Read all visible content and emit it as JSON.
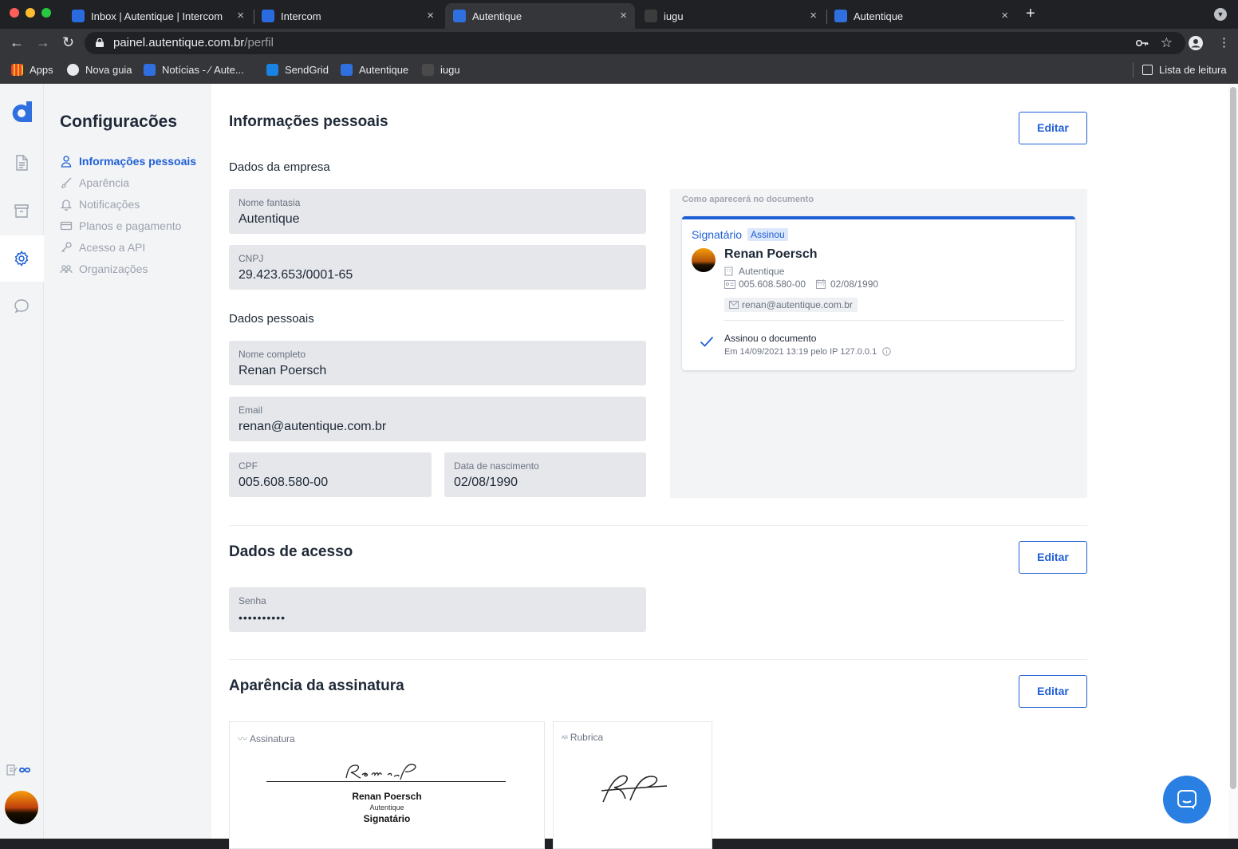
{
  "browser": {
    "tabs": [
      {
        "title": "Inbox | Autentique | Intercom",
        "active": false
      },
      {
        "title": "Intercom",
        "active": false
      },
      {
        "title": "Autentique",
        "active": true
      },
      {
        "title": "iugu",
        "active": false
      },
      {
        "title": "Autentique",
        "active": false
      }
    ],
    "close_glyph": "×",
    "new_tab_glyph": "+",
    "url_host": "painel.autentique.com.br",
    "url_path": "/perfil",
    "bookmarks": [
      "Apps",
      "Nova guia",
      "Notícias - ",
      "Aute...",
      "SendGrid",
      "Autentique",
      "iugu"
    ],
    "reading_list": "Lista de leitura"
  },
  "sidebar": {
    "title": "Configuracões",
    "items": [
      {
        "label": "Informações pessoais",
        "icon": "user-icon",
        "active": true
      },
      {
        "label": "Aparência",
        "icon": "brush-icon",
        "active": false
      },
      {
        "label": "Notificações",
        "icon": "bell-icon",
        "active": false
      },
      {
        "label": "Planos e pagamento",
        "icon": "card-icon",
        "active": false
      },
      {
        "label": "Acesso a API",
        "icon": "key-icon",
        "active": false
      },
      {
        "label": "Organizações",
        "icon": "users-icon",
        "active": false
      }
    ]
  },
  "personal": {
    "title": "Informações pessoais",
    "edit_label": "Editar",
    "company_heading": "Dados da empresa",
    "trade_name_label": "Nome fantasia",
    "trade_name": "Autentique",
    "cnpj_label": "CNPJ",
    "cnpj": "29.423.653/0001-65",
    "personal_heading": "Dados pessoais",
    "full_name_label": "Nome completo",
    "full_name": "Renan Poersch",
    "email_label": "Email",
    "email": "renan@autentique.com.br",
    "cpf_label": "CPF",
    "cpf": "005.608.580-00",
    "birth_label": "Data de nascimento",
    "birth": "02/08/1990"
  },
  "preview": {
    "caption": "Como aparecerá no documento",
    "role": "Signatário",
    "badge": "Assinou",
    "name": "Renan Poersch",
    "company": "Autentique",
    "cpf": "005.608.580-00",
    "birth": "02/08/1990",
    "email": "renan@autentique.com.br",
    "signed": "Assinou o documento",
    "signed_detail": "Em 14/09/2021 13:19 pelo IP 127.0.0.1"
  },
  "access": {
    "title": "Dados de acesso",
    "edit_label": "Editar",
    "password_label": "Senha",
    "password": "••••••••••"
  },
  "signature": {
    "title": "Aparência da assinatura",
    "edit_label": "Editar",
    "sign_caption": "Assinatura",
    "initials_caption": "Rubrica",
    "sign_name": "Renan Poersch",
    "sign_company": "Autentique",
    "sign_role": "Signatário"
  },
  "colors": {
    "accent": "#1f5fd6",
    "field_bg": "#e5e7eb",
    "intercom": "#2a7fe3"
  }
}
